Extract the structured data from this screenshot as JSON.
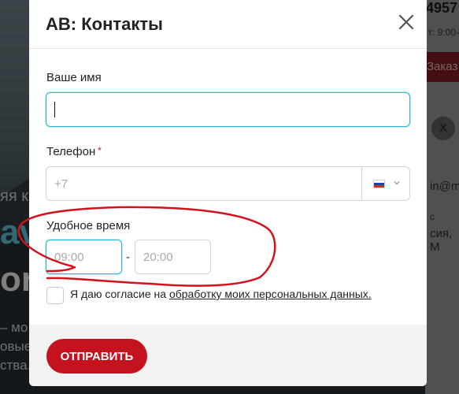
{
  "background": {
    "phone_fragment": "4957",
    "hours_fragment": "т: 9:00-",
    "order_button": "Заказ",
    "social_x": "X",
    "email_fragment": "in@m",
    "city_fragment": "сия, М",
    "fragment_s": "с",
    "left_text_1": "яя к",
    "left_big_1": "av",
    "left_big_2": "or",
    "left_text_2": "– мо",
    "left_text_3": "овые",
    "left_text_4": "ства."
  },
  "modal": {
    "title": "АВ: Контакты",
    "close_icon": "close-icon",
    "name": {
      "label": "Ваше имя",
      "value": ""
    },
    "phone": {
      "label": "Телефон",
      "required_mark": "*",
      "placeholder": "+7",
      "country_flag": "russia-flag-icon"
    },
    "time": {
      "label": "Удобное время",
      "from_placeholder": "09:00",
      "separator": "-",
      "to_placeholder": "20:00"
    },
    "consent": {
      "text_before": "Я даю согласие на ",
      "link_text": "обработку моих персональных данных.",
      "checked": false
    },
    "submit_label": "ОТПРАВИТЬ"
  },
  "colors": {
    "accent_red": "#c5121f",
    "focus_blue": "#28b6d3",
    "annotation_red": "#d0121c"
  }
}
